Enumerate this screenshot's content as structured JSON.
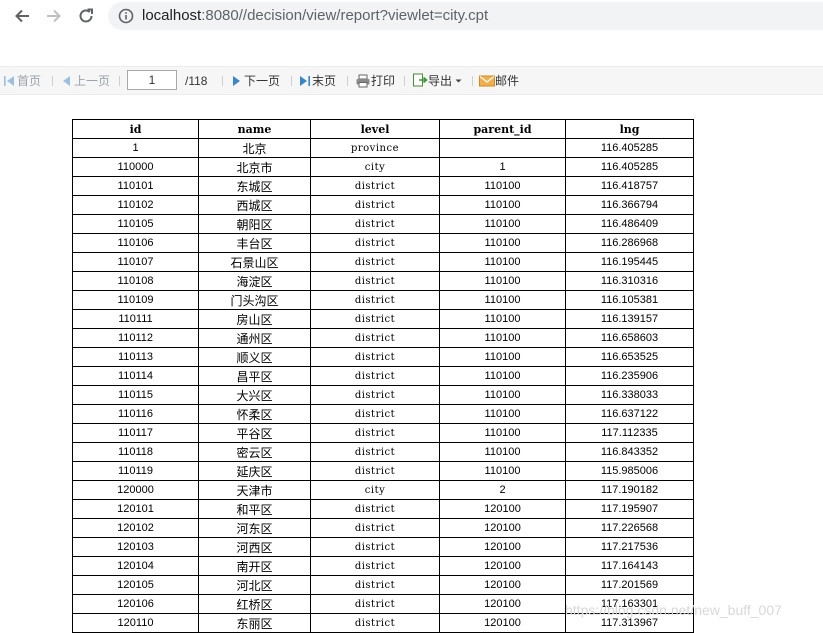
{
  "browser": {
    "url_host": "localhost",
    "url_rest": ":8080//decision/view/report?viewlet=city.cpt"
  },
  "toolbar": {
    "first_label": "首页",
    "prev_label": "上一页",
    "page_value": "1",
    "page_total": "/118",
    "next_label": "下一页",
    "last_label": "末页",
    "print_label": "打印",
    "export_label": "导出",
    "mail_label": "邮件"
  },
  "table": {
    "headers": [
      "id",
      "name",
      "level",
      "parent_id",
      "lng"
    ],
    "rows": [
      [
        "1",
        "北京",
        "province",
        "",
        "116.405285"
      ],
      [
        "110000",
        "北京市",
        "city",
        "1",
        "116.405285"
      ],
      [
        "110101",
        "东城区",
        "district",
        "110100",
        "116.418757"
      ],
      [
        "110102",
        "西城区",
        "district",
        "110100",
        "116.366794"
      ],
      [
        "110105",
        "朝阳区",
        "district",
        "110100",
        "116.486409"
      ],
      [
        "110106",
        "丰台区",
        "district",
        "110100",
        "116.286968"
      ],
      [
        "110107",
        "石景山区",
        "district",
        "110100",
        "116.195445"
      ],
      [
        "110108",
        "海淀区",
        "district",
        "110100",
        "116.310316"
      ],
      [
        "110109",
        "门头沟区",
        "district",
        "110100",
        "116.105381"
      ],
      [
        "110111",
        "房山区",
        "district",
        "110100",
        "116.139157"
      ],
      [
        "110112",
        "通州区",
        "district",
        "110100",
        "116.658603"
      ],
      [
        "110113",
        "顺义区",
        "district",
        "110100",
        "116.653525"
      ],
      [
        "110114",
        "昌平区",
        "district",
        "110100",
        "116.235906"
      ],
      [
        "110115",
        "大兴区",
        "district",
        "110100",
        "116.338033"
      ],
      [
        "110116",
        "怀柔区",
        "district",
        "110100",
        "116.637122"
      ],
      [
        "110117",
        "平谷区",
        "district",
        "110100",
        "117.112335"
      ],
      [
        "110118",
        "密云区",
        "district",
        "110100",
        "116.843352"
      ],
      [
        "110119",
        "延庆区",
        "district",
        "110100",
        "115.985006"
      ],
      [
        "120000",
        "天津市",
        "city",
        "2",
        "117.190182"
      ],
      [
        "120101",
        "和平区",
        "district",
        "120100",
        "117.195907"
      ],
      [
        "120102",
        "河东区",
        "district",
        "120100",
        "117.226568"
      ],
      [
        "120103",
        "河西区",
        "district",
        "120100",
        "117.217536"
      ],
      [
        "120104",
        "南开区",
        "district",
        "120100",
        "117.164143"
      ],
      [
        "120105",
        "河北区",
        "district",
        "120100",
        "117.201569"
      ],
      [
        "120106",
        "红桥区",
        "district",
        "120100",
        "117.163301"
      ],
      [
        "120110",
        "东丽区",
        "district",
        "120100",
        "117.313967"
      ]
    ]
  },
  "watermark": "https://blog.csdn.net/new_buff_007",
  "colors": {
    "toolbar_bg": "#f6f6f6",
    "nav_icon_blue": "#3b86c8",
    "mail_icon": "#e8a040"
  }
}
